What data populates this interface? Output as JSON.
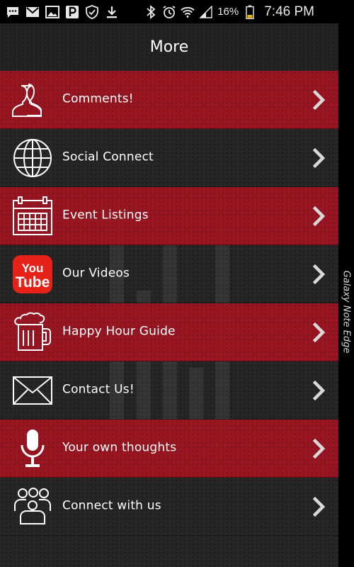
{
  "status_bar": {
    "battery_percent": "16%",
    "time": "7:46 PM",
    "icons": [
      "chat-icon",
      "gmail-icon",
      "image-icon",
      "parking-icon",
      "shield-icon",
      "download-icon",
      "bluetooth-icon",
      "alarm-icon",
      "wifi-icon",
      "signal-icon",
      "battery-icon"
    ]
  },
  "header": {
    "title": "More"
  },
  "menu": {
    "items": [
      {
        "label": "Comments!",
        "icon": "users-icon",
        "style": "red"
      },
      {
        "label": "Social Connect",
        "icon": "globe-icon",
        "style": "dark"
      },
      {
        "label": "Event Listings",
        "icon": "calendar-icon",
        "style": "red"
      },
      {
        "label": "Our Videos",
        "icon": "youtube-icon",
        "style": "dark"
      },
      {
        "label": "Happy Hour Guide",
        "icon": "beer-mug-icon",
        "style": "red"
      },
      {
        "label": "Contact Us!",
        "icon": "envelope-icon",
        "style": "dark"
      },
      {
        "label": "Your own thoughts",
        "icon": "microphone-icon",
        "style": "red"
      },
      {
        "label": "Connect with us",
        "icon": "group-icon",
        "style": "dark"
      }
    ]
  },
  "youtube_logo": {
    "top": "You",
    "bottom": "Tube"
  },
  "device_edge_label": "Galaxy Note Edge",
  "colors": {
    "row_red": "#a01622",
    "row_dark": "#262626",
    "text": "#ffffff",
    "chevron": "#d9d9d9"
  }
}
